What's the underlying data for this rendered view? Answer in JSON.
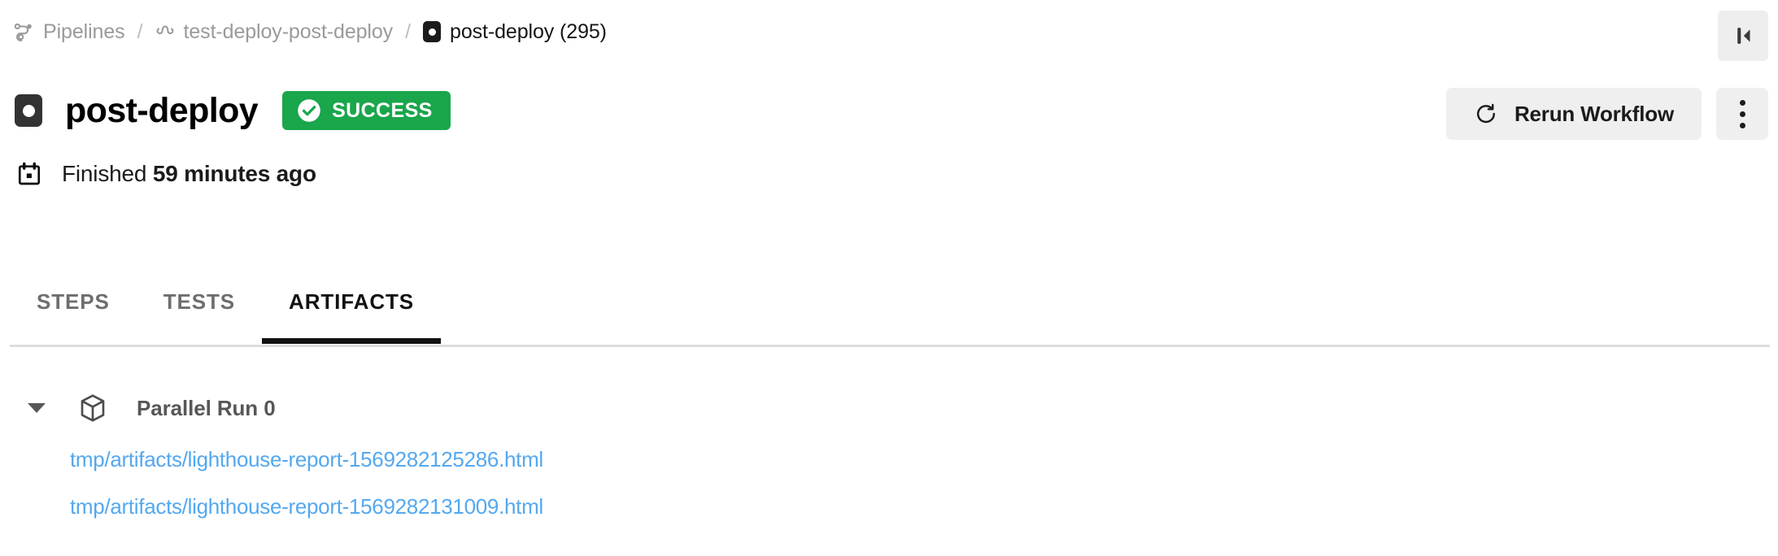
{
  "breadcrumb": {
    "items": [
      {
        "label": "Pipelines",
        "icon": "pipelines-icon",
        "current": false
      },
      {
        "label": "test-deploy-post-deploy",
        "icon": "branch-icon",
        "current": false
      },
      {
        "label": "post-deploy (295)",
        "icon": "job-icon",
        "current": true
      }
    ],
    "separator": "/"
  },
  "topbar": {
    "collapse_icon": "collapse-sidebar-icon"
  },
  "header": {
    "job_icon": "job-icon",
    "title": "post-deploy",
    "status": {
      "label": "SUCCESS",
      "icon": "check-circle-icon",
      "color": "#1aa64b"
    },
    "meta": {
      "icon": "calendar-icon",
      "prefix": "Finished ",
      "relative_time": "59 minutes ago"
    }
  },
  "actions": {
    "rerun": {
      "label": "Rerun Workflow",
      "icon": "refresh-icon"
    },
    "more": {
      "icon": "kebab-menu-icon",
      "label": "More actions"
    }
  },
  "tabs": [
    {
      "label": "STEPS",
      "active": false
    },
    {
      "label": "TESTS",
      "active": false
    },
    {
      "label": "ARTIFACTS",
      "active": true
    }
  ],
  "artifacts": {
    "groups": [
      {
        "label": "Parallel Run 0",
        "icon": "cube-icon",
        "caret": "chevron-down-icon",
        "expanded": true,
        "files": [
          "tmp/artifacts/lighthouse-report-1569282125286.html",
          "tmp/artifacts/lighthouse-report-1569282131009.html"
        ]
      }
    ]
  },
  "colors": {
    "link": "#54a8ef",
    "success": "#1aa64b",
    "muted": "#9a9a9a",
    "text": "#1b1b1b"
  }
}
